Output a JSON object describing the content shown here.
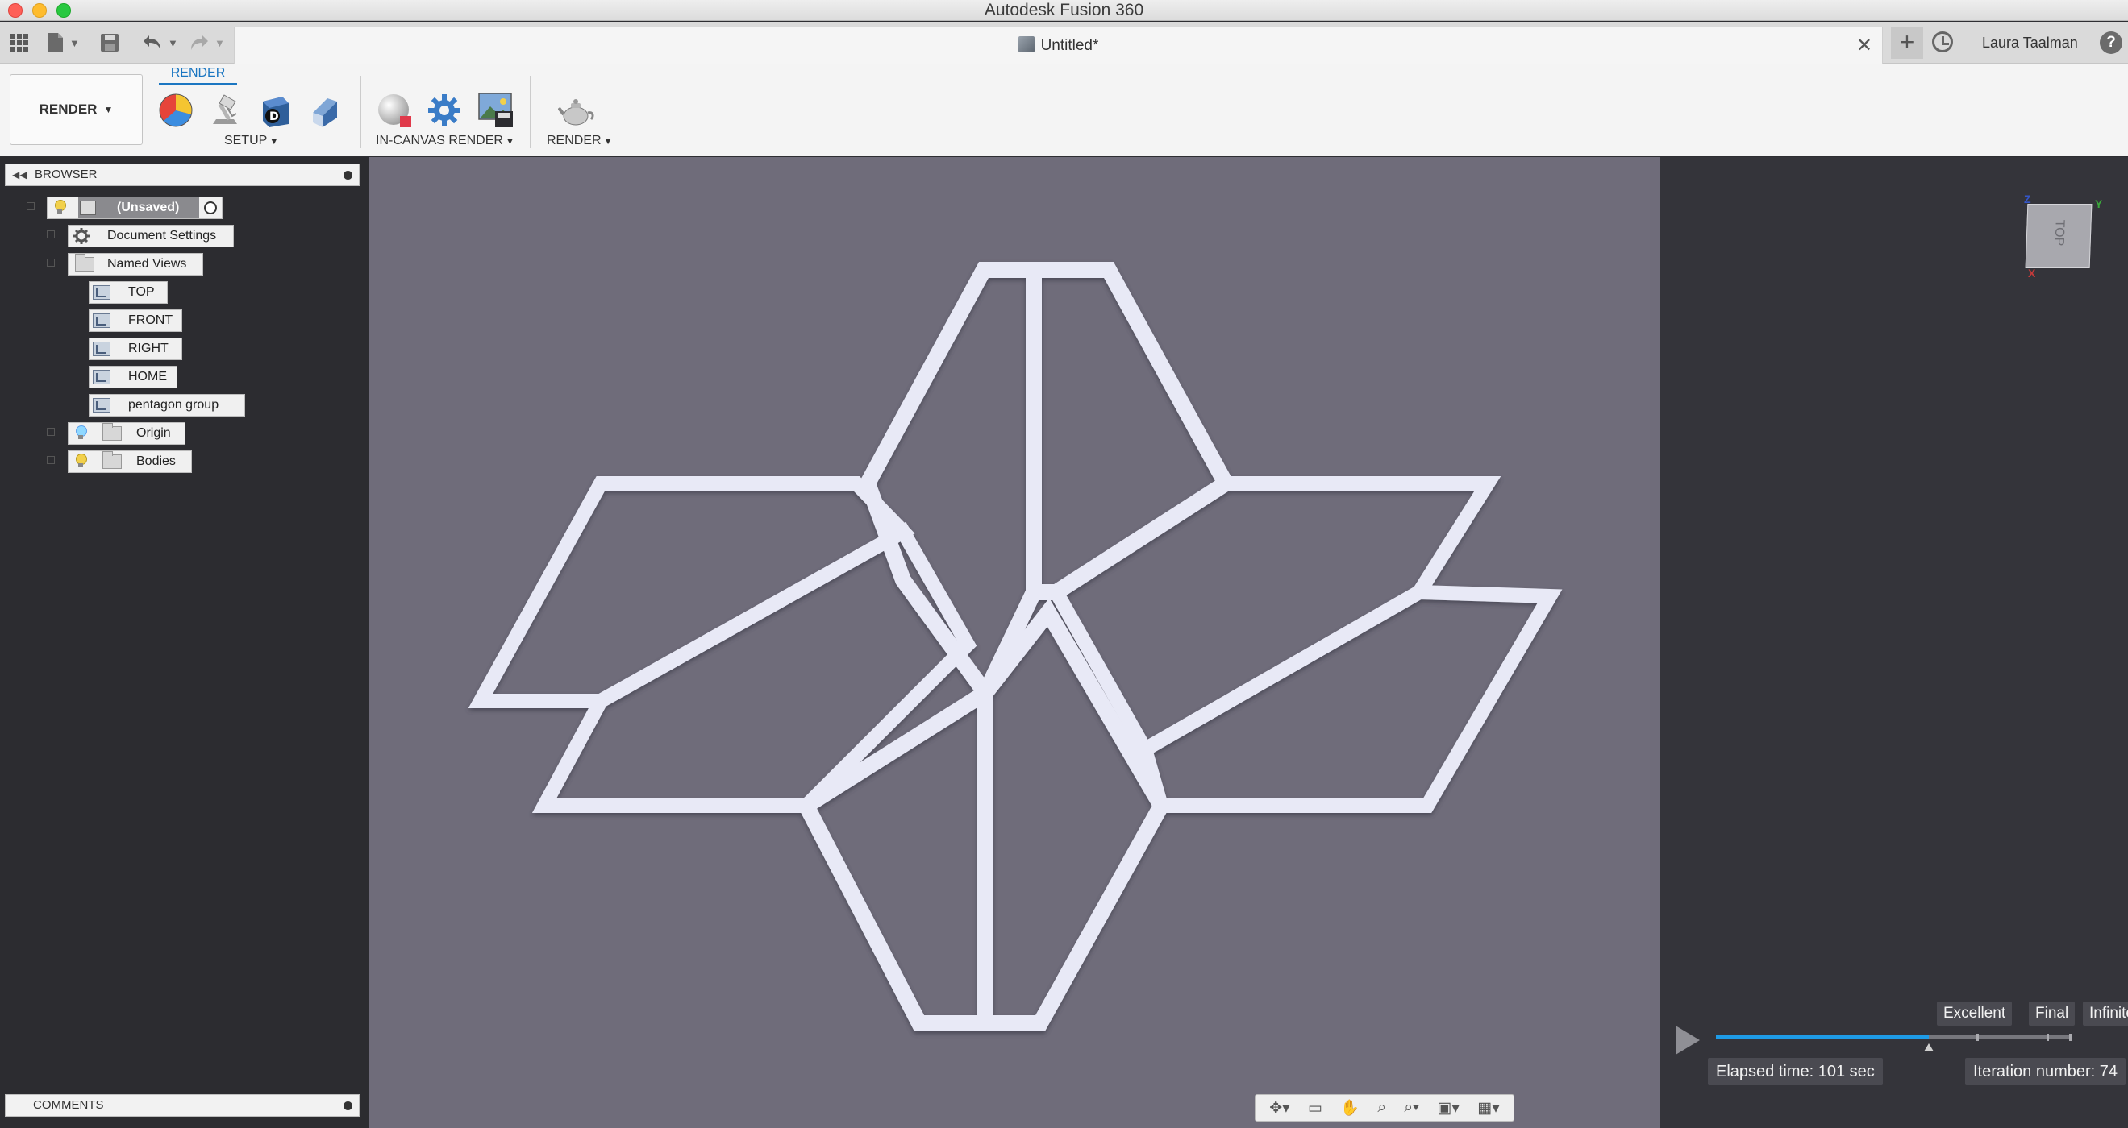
{
  "window": {
    "title": "Autodesk Fusion 360"
  },
  "tabbar": {
    "document_title": "Untitled*",
    "user": "Laura Taalman",
    "help": "?"
  },
  "ribbon": {
    "workspace": "RENDER",
    "active_tab": "RENDER",
    "groups": {
      "setup": "SETUP",
      "in_canvas_render": "IN-CANVAS RENDER",
      "render": "RENDER"
    }
  },
  "browser": {
    "title": "BROWSER",
    "root": "(Unsaved)",
    "items": {
      "document_settings": "Document Settings",
      "named_views": "Named Views",
      "views": [
        "TOP",
        "FRONT",
        "RIGHT",
        "HOME",
        "pentagon group"
      ],
      "origin": "Origin",
      "bodies": "Bodies"
    }
  },
  "comments": {
    "title": "COMMENTS"
  },
  "viewcube": {
    "face": "TOP",
    "axes": {
      "z": "Z",
      "y": "Y",
      "x": "X"
    }
  },
  "render_quality": {
    "levels": [
      "Excellent",
      "Final",
      "Infinite"
    ],
    "progress": 0.6,
    "elapsed": "Elapsed time: 101 sec",
    "iteration": "Iteration number: 74"
  },
  "colors": {
    "canvas_bg": "#6f6c7a",
    "model": "#e8e9f6",
    "accent": "#1b76c1",
    "progress": "#1e9be6"
  },
  "icons": {
    "grid": "app-grid-icon",
    "file": "file-icon",
    "save": "save-icon",
    "undo": "undo-icon",
    "redo": "redo-icon",
    "appearance": "appearance-icon",
    "scene_settings": "scene-settings-icon",
    "decal": "decal-icon",
    "texture": "texture-map-icon",
    "in_canvas": "in-canvas-render-icon",
    "render_settings": "render-settings-icon",
    "capture": "capture-image-icon",
    "render_teapot": "render-teapot-icon"
  }
}
